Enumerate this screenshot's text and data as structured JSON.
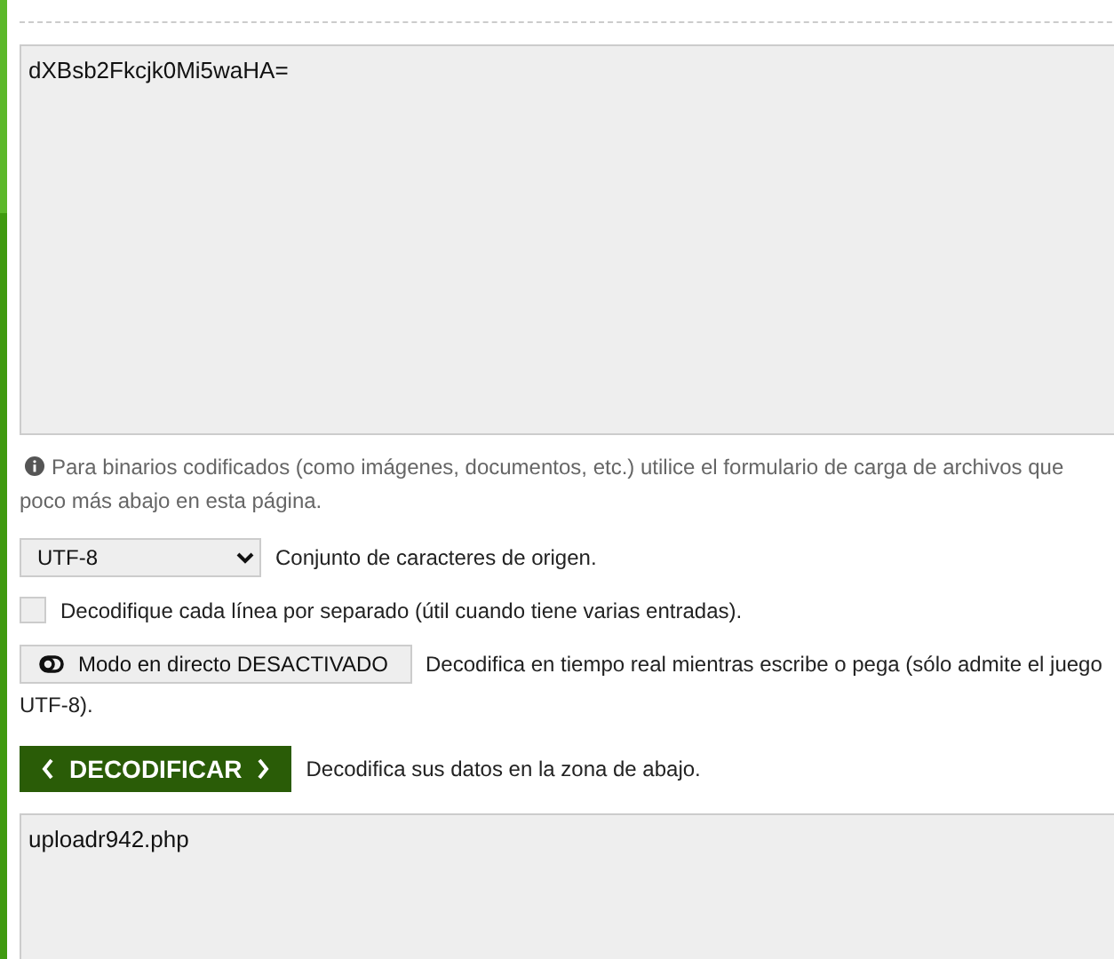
{
  "input": {
    "value": "dXBsb2Fkcjk0Mi5waHA="
  },
  "note_lines": [
    "Para binarios codificados (como imágenes, documentos, etc.) utilice el formulario de carga de archivos que",
    "poco más abajo en esta página."
  ],
  "charset": {
    "value": "UTF-8",
    "label": "Conjunto de caracteres de origen."
  },
  "per_line": {
    "checked": false,
    "label": "Decodifique cada línea por separado (útil cuando tiene varias entradas)."
  },
  "live_mode": {
    "on": false,
    "label": "Modo en directo DESACTIVADO",
    "description_lines": [
      "Decodifica en tiempo real mientras escribe o pega (sólo admite el juego",
      "UTF-8)."
    ]
  },
  "decode": {
    "label": "DECODIFICAR",
    "description": "Decodifica sus datos en la zona de abajo."
  },
  "output": {
    "value": "uploadr942.php"
  }
}
